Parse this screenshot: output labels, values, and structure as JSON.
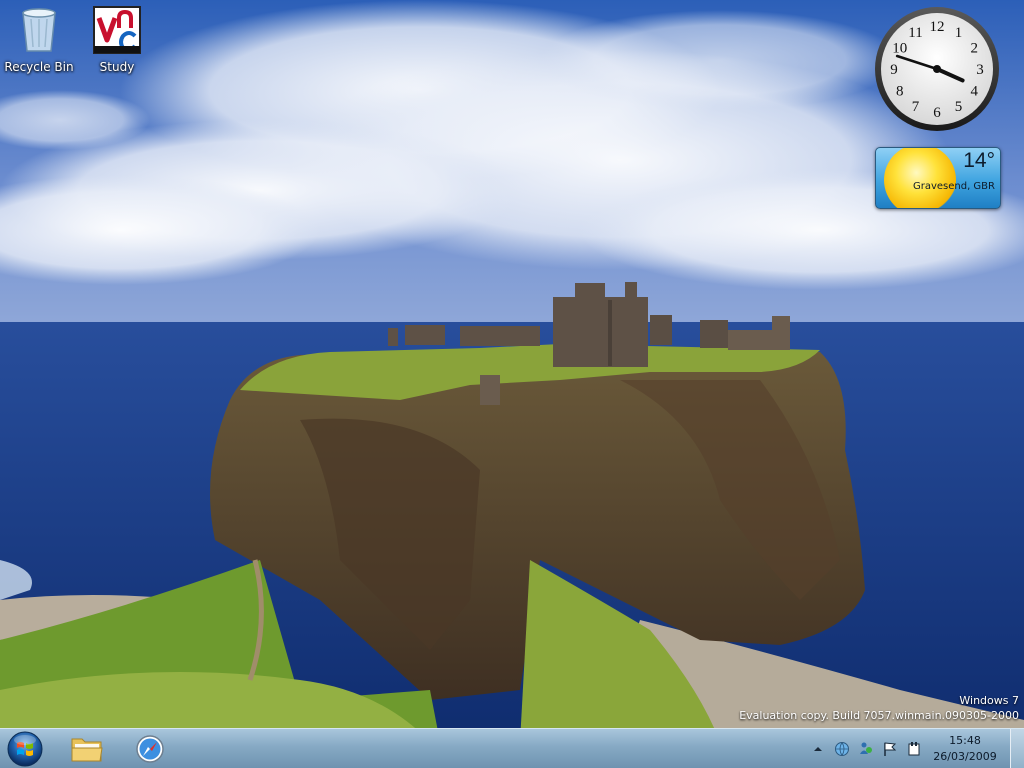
{
  "desktop": {
    "icons": [
      {
        "label": "Recycle Bin",
        "icon": "recycle-bin-icon"
      },
      {
        "label": "Study",
        "icon": "vnc-icon"
      }
    ]
  },
  "clock": {
    "numbers": [
      "12",
      "1",
      "2",
      "3",
      "4",
      "5",
      "6",
      "7",
      "8",
      "9",
      "10",
      "11"
    ],
    "hour": 15,
    "minute": 48
  },
  "weather": {
    "temperature": "14°",
    "location": "Gravesend, GBR"
  },
  "watermark": {
    "line1": "Windows 7",
    "line2": "Evaluation copy. Build 7057.winmain.090305-2000"
  },
  "taskbar": {
    "buttons": [
      {
        "name": "start",
        "icon": "windows-orb-icon"
      },
      {
        "name": "windows-explorer",
        "icon": "folder-icon"
      },
      {
        "name": "safari",
        "icon": "compass-icon"
      }
    ],
    "tray": {
      "icons": [
        "chevron-up-icon",
        "network-globe-icon",
        "users-icon",
        "flag-icon",
        "power-icon"
      ],
      "time": "15:48",
      "date": "26/03/2009"
    }
  },
  "colors": {
    "sky": "#3b6fc2",
    "sea": "#1d3f8a",
    "grass": "#7fa32f",
    "taskbar": "#86a9c4"
  }
}
